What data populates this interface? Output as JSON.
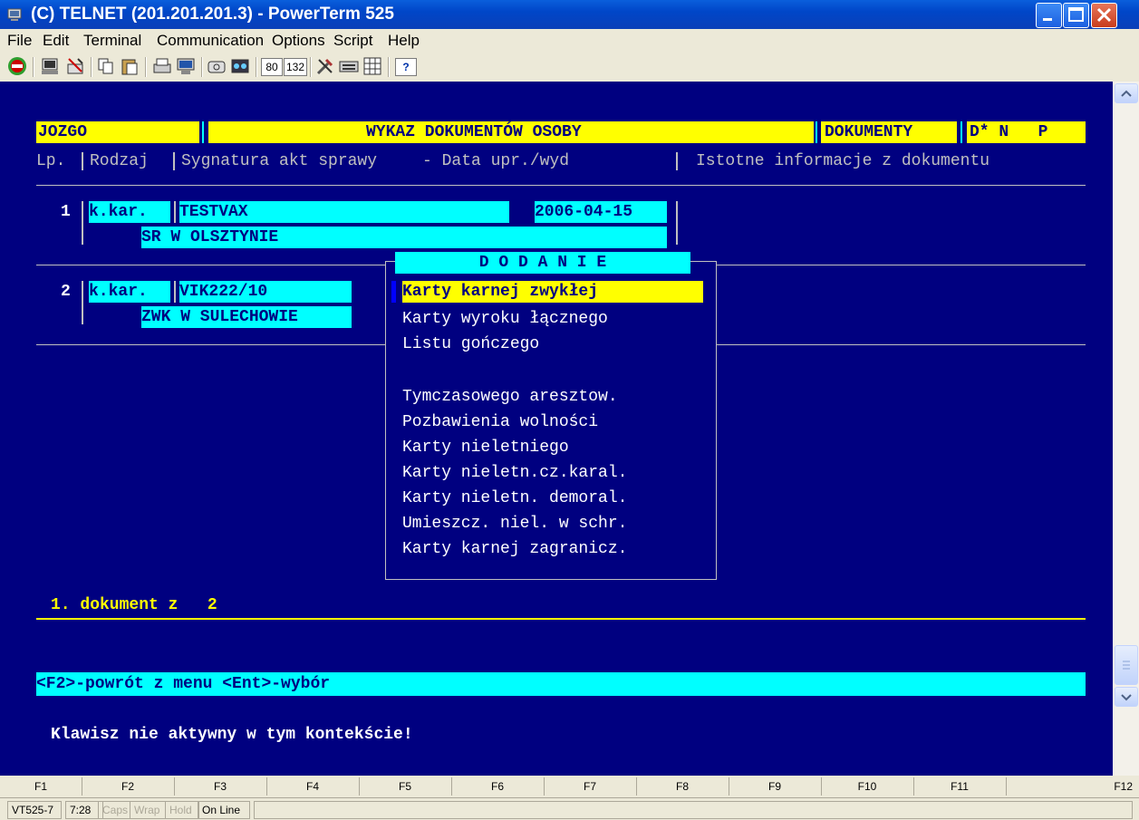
{
  "window": {
    "title": "(C) TELNET (201.201.201.3) - PowerTerm 525"
  },
  "menu": [
    "File",
    "Edit",
    "Terminal",
    "Communication",
    "Options",
    "Script",
    "Help"
  ],
  "toolbar": {
    "cols80": "80",
    "cols132": "132",
    "help": "?"
  },
  "terminal": {
    "header": {
      "user": "JOZGO",
      "title": "WYKAZ DOKUMENTÓW OSOBY",
      "section": "DOKUMENTY",
      "flags": "D* N   P"
    },
    "columns": {
      "lp": "Lp.",
      "rodzaj": "Rodzaj",
      "sygnatura": "Sygnatura akt sprawy",
      "data": "- Data upr./wyd",
      "info": "Istotne informacje z dokumentu"
    },
    "rows": [
      {
        "lp": "1",
        "rodzaj": "k.kar.",
        "sygnatura": "TESTVAX",
        "data": "2006-04-15",
        "sad": "SR W OLSZTYNIE"
      },
      {
        "lp": "2",
        "rodzaj": "k.kar.",
        "sygnatura": "VIK222/10",
        "data": "",
        "sad": "ZWK W SULECHOWIE"
      }
    ],
    "popup": {
      "title": "D O D A N I E",
      "items": [
        "Karty karnej zwykłej",
        "Karty wyroku łącznego",
        "Listu gończego",
        "",
        "Tymczasowego aresztow.",
        "Pozbawienia wolności",
        "Karty nieletniego",
        "Karty nieletn.cz.karal.",
        "Karty nieletn. demoral.",
        "Umieszcz. niel. w schr.",
        "Karty karnej zagranicz."
      ],
      "selected_index": 0
    },
    "counter": "1. dokument z   2",
    "hint": "<F2>-powrót z menu <Ent>-wybór",
    "message": "Klawisz nie aktywny w tym kontekście!"
  },
  "fkeys": [
    "F1",
    "F2",
    "F3",
    "F4",
    "F5",
    "F6",
    "F7",
    "F8",
    "F9",
    "F10",
    "F11",
    "F12"
  ],
  "statusbar": {
    "emulation": "VT525-7",
    "time": "7:28",
    "caps": "Caps",
    "wrap": "Wrap",
    "hold": "Hold",
    "online": "On Line"
  }
}
